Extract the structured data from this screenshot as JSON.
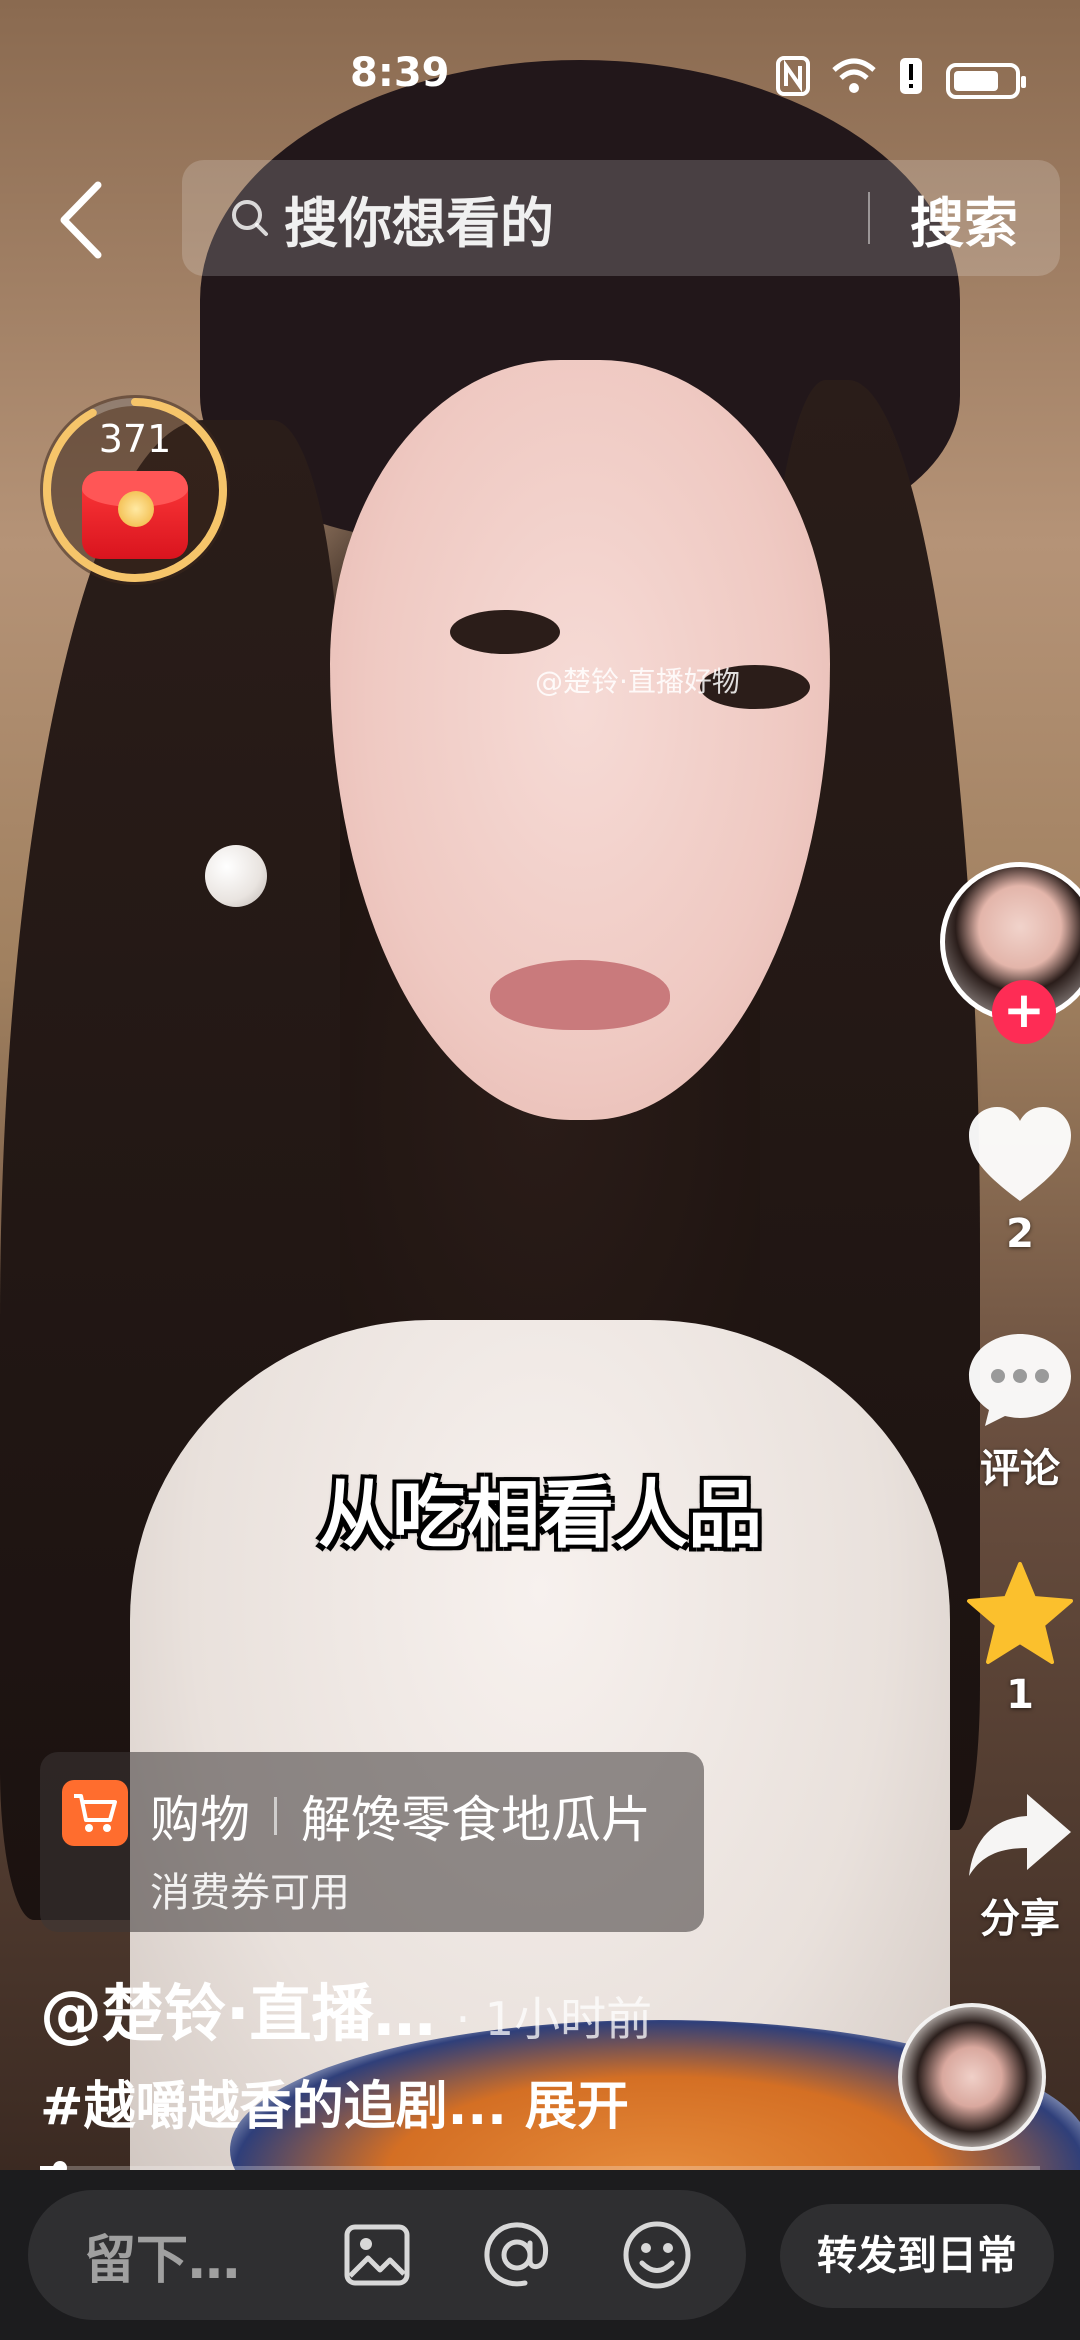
{
  "status_bar": {
    "time": "8:39",
    "battery_level": 0.75,
    "icons": [
      "nfc-icon",
      "wifi-icon",
      "alert-icon",
      "battery-icon"
    ]
  },
  "top_bar": {
    "search_placeholder": "搜你想看的",
    "search_button": "搜索"
  },
  "red_packet": {
    "countdown": "371",
    "ring_progress": 0.92
  },
  "video": {
    "watermark": "@楚铃·直播好物",
    "subtitle": "从吃相看人品"
  },
  "side_actions": {
    "follow_symbol": "+",
    "like_count": "2",
    "comment_label": "评论",
    "favorite_count": "1",
    "share_label": "分享"
  },
  "shopping": {
    "tag": "购物",
    "product": "解馋零食地瓜片",
    "coupon": "消费券可用"
  },
  "post": {
    "author": "@楚铃·直播…",
    "time_ago": "· 1小时前",
    "description": "#越嚼越香的追剧...",
    "expand": "展开",
    "progress": 0.02
  },
  "comment_bar": {
    "placeholder": "留下…",
    "repost_button": "转发到日常"
  },
  "colors": {
    "accent_red": "#fe2c55",
    "favorite_yellow": "#fbc02d",
    "cart_orange": "#ff6d2e",
    "bottom_bg": "#1c1c1e"
  }
}
